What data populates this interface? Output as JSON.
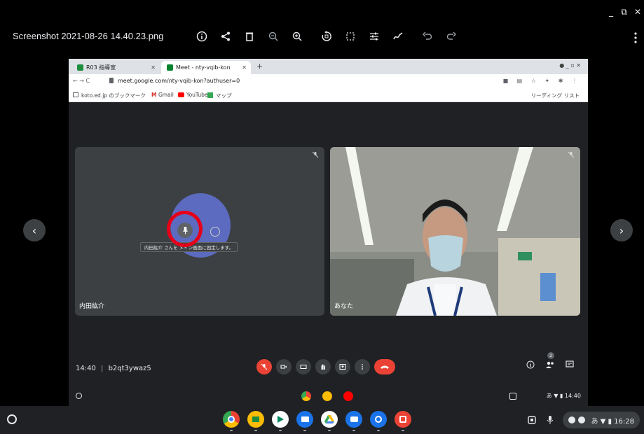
{
  "gallery": {
    "title": "Screenshot 2021-08-26 14.40.23.png",
    "tools": [
      "info-icon",
      "share-icon",
      "delete-icon",
      "zoom-out-icon",
      "zoom-in-icon",
      "rotate-icon",
      "crop-icon",
      "adjust-icon",
      "annotate-icon",
      "undo-icon",
      "redo-icon"
    ],
    "window_controls": [
      "_",
      "⧉",
      "✕"
    ]
  },
  "browser": {
    "tabs": [
      {
        "label": "R03 指導室",
        "active": false
      },
      {
        "label": "Meet - nty-vqib-kon",
        "active": true
      }
    ],
    "url": "meet.google.com/nty-vqib-kon?authuser=0",
    "bookmarks": [
      "koto.ed.jp のブックマーク",
      "Gmail",
      "YouTube",
      "マップ"
    ],
    "reading_list": "リーディング リスト"
  },
  "meet": {
    "participants": [
      {
        "name": "内田紘介"
      },
      {
        "name": "あなた"
      }
    ],
    "tooltip": "内田紘介 さんを メイン画面に固定します。",
    "time": "14:40",
    "meeting_code": "b2qt3ywaz5",
    "participant_count": "2"
  },
  "inner_status": "あ ▼ ▮ 14:40",
  "shelf": {
    "status": "あ ▼ ▮ 16:28"
  },
  "colors": {
    "accent_red": "#e5001a",
    "meet_red": "#ea4335",
    "avatar": "#5c6bc0"
  }
}
